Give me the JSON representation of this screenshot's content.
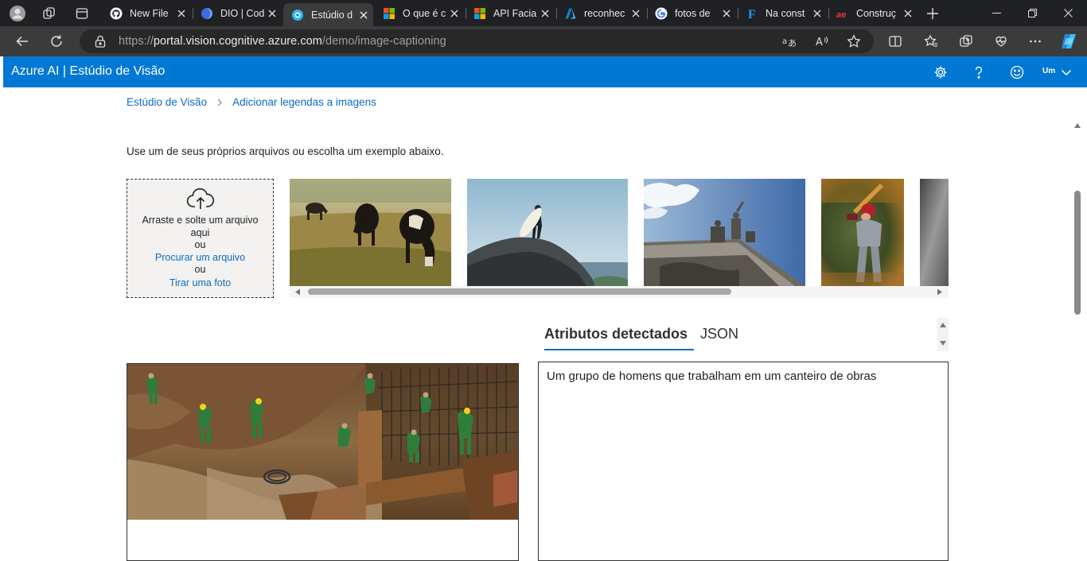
{
  "browser": {
    "tabs": [
      {
        "title": "New File",
        "favicon": "github-icon"
      },
      {
        "title": "DIO | Cod",
        "favicon": "dio-icon"
      },
      {
        "title": "Estúdio d",
        "favicon": "vision-studio-icon",
        "active": true
      },
      {
        "title": "O que é c",
        "favicon": "microsoft-icon"
      },
      {
        "title": "API Facia",
        "favicon": "microsoft-icon"
      },
      {
        "title": "reconhec",
        "favicon": "azure-icon"
      },
      {
        "title": "fotos de",
        "favicon": "google-icon"
      },
      {
        "title": "Na const",
        "favicon": "f-icon"
      },
      {
        "title": "Construç",
        "favicon": "ae-icon"
      }
    ],
    "url_scheme": "https://",
    "url_host": "portal.vision.cognitive.azure.com",
    "url_path": "/demo/image-captioning"
  },
  "header": {
    "brand": "Azure AI | Estúdio de Visão",
    "user_initials": "Um"
  },
  "breadcrumb": {
    "root": "Estúdio de Visão",
    "current": "Adicionar legendas a imagens"
  },
  "instructions": "Use um de seus próprios arquivos ou escolha um exemplo abaixo.",
  "upload": {
    "drag_text": "Arraste e solte um arquivo aqui",
    "or1": "ou",
    "browse_link": "Procurar um arquivo",
    "or2": "ou",
    "photo_link": "Tirar uma foto"
  },
  "samples": [
    "cows-grazing",
    "surfer-on-rock",
    "building-statues",
    "baseball-batter",
    "gray-partial"
  ],
  "result_tabs": {
    "active": "Atributos detectados",
    "json": "JSON"
  },
  "caption": "Um grupo de homens que trabalham em um canteiro de obras",
  "colors": {
    "brand": "#0078d4",
    "link": "#0f6cbd"
  }
}
